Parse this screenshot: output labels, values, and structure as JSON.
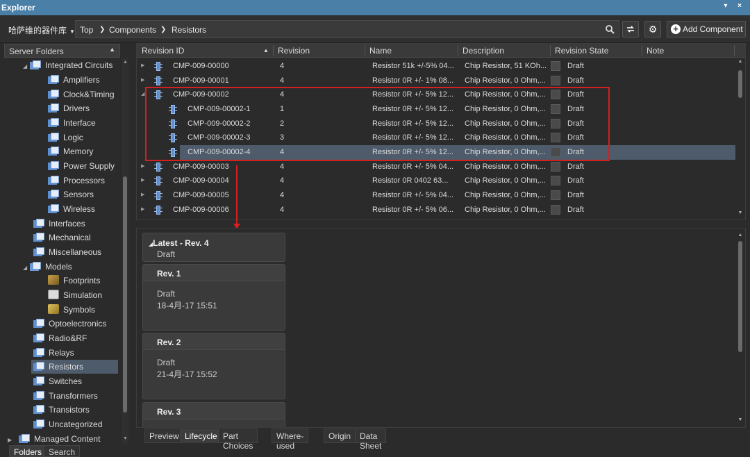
{
  "window": {
    "title": "Explorer",
    "controls": "▾ ×"
  },
  "toolbar": {
    "vault": "哈萨维的器件库",
    "breadcrumb": [
      "Top",
      "Components",
      "Resistors"
    ],
    "add_component": "Add Component"
  },
  "left_panel": {
    "header": "Server Folders",
    "items": [
      {
        "label": "Integrated Circuits",
        "level": 1,
        "expanded": true
      },
      {
        "label": "Amplifiers",
        "level": 2
      },
      {
        "label": "Clock&Timing",
        "level": 2
      },
      {
        "label": "Drivers",
        "level": 2
      },
      {
        "label": "Interface",
        "level": 2
      },
      {
        "label": "Logic",
        "level": 2
      },
      {
        "label": "Memory",
        "level": 2
      },
      {
        "label": "Power Supply",
        "level": 2
      },
      {
        "label": "Processors",
        "level": 2
      },
      {
        "label": "Sensors",
        "level": 2
      },
      {
        "label": "Wireless",
        "level": 2
      },
      {
        "label": "Interfaces",
        "level": 1
      },
      {
        "label": "Mechanical",
        "level": 1
      },
      {
        "label": "Miscellaneous",
        "level": 1
      },
      {
        "label": "Models",
        "level": 1,
        "expanded": true
      },
      {
        "label": "Footprints",
        "level": 2
      },
      {
        "label": "Simulation",
        "level": 2
      },
      {
        "label": "Symbols",
        "level": 2
      },
      {
        "label": "Optoelectronics",
        "level": 1
      },
      {
        "label": "Radio&RF",
        "level": 1
      },
      {
        "label": "Relays",
        "level": 1
      },
      {
        "label": "Resistors",
        "level": 1,
        "selected": true
      },
      {
        "label": "Switches",
        "level": 1
      },
      {
        "label": "Transformers",
        "level": 1
      },
      {
        "label": "Transistors",
        "level": 1
      },
      {
        "label": "Uncategorized",
        "level": 1
      },
      {
        "label": "Managed Content",
        "level": 0
      }
    ],
    "tabs": [
      "Folders",
      "Search"
    ]
  },
  "grid": {
    "columns": [
      "Revision ID",
      "Revision",
      "Name",
      "Description",
      "Revision State",
      "Note"
    ],
    "rows": [
      {
        "id": "CMP-009-00000",
        "rev": "4",
        "name": "Resistor 51k +/-5% 04...",
        "desc": "Chip Resistor, 51 KOh...",
        "state": "Draft"
      },
      {
        "id": "CMP-009-00001",
        "rev": "4",
        "name": "Resistor 0R +/- 1% 08...",
        "desc": "Chip Resistor, 0 Ohm,...",
        "state": "Draft"
      },
      {
        "id": "CMP-009-00002",
        "rev": "4",
        "name": "Resistor 0R +/- 5% 12...",
        "desc": "Chip Resistor, 0 Ohm,...",
        "state": "Draft",
        "expanded": true
      },
      {
        "id": "CMP-009-00002-1",
        "rev": "1",
        "name": "Resistor 0R +/- 5% 12...",
        "desc": "Chip Resistor, 0 Ohm,...",
        "state": "Draft",
        "child": true
      },
      {
        "id": "CMP-009-00002-2",
        "rev": "2",
        "name": "Resistor 0R +/- 5% 12...",
        "desc": "Chip Resistor, 0 Ohm,...",
        "state": "Draft",
        "child": true
      },
      {
        "id": "CMP-009-00002-3",
        "rev": "3",
        "name": "Resistor 0R +/- 5% 12...",
        "desc": "Chip Resistor, 0 Ohm,...",
        "state": "Draft",
        "child": true
      },
      {
        "id": "CMP-009-00002-4",
        "rev": "4",
        "name": "Resistor 0R +/- 5% 12...",
        "desc": "Chip Resistor, 0 Ohm,...",
        "state": "Draft",
        "child": true,
        "selected": true
      },
      {
        "id": "CMP-009-00003",
        "rev": "4",
        "name": "Resistor 0R +/- 5% 04...",
        "desc": "Chip Resistor, 0 Ohm,...",
        "state": "Draft"
      },
      {
        "id": "CMP-009-00004",
        "rev": "4",
        "name": "Resistor 0R 0402 63...",
        "desc": "Chip Resistor, 0 Ohm,...",
        "state": "Draft"
      },
      {
        "id": "CMP-009-00005",
        "rev": "4",
        "name": "Resistor 0R +/- 5% 04...",
        "desc": "Chip Resistor, 0 Ohm,...",
        "state": "Draft"
      },
      {
        "id": "CMP-009-00006",
        "rev": "4",
        "name": "Resistor 0R +/- 5% 06...",
        "desc": "Chip Resistor, 0 Ohm,...",
        "state": "Draft"
      }
    ]
  },
  "lifecycle": {
    "latest": {
      "title": "Latest - Rev.  4",
      "state": "Draft"
    },
    "revisions": [
      {
        "title": "Rev. 1",
        "state": "Draft",
        "date": "18-4月-17 15:51"
      },
      {
        "title": "Rev. 2",
        "state": "Draft",
        "date": "21-4月-17 15:52"
      },
      {
        "title": "Rev. 3"
      }
    ]
  },
  "detail_tabs": [
    "Preview",
    "Lifecycle",
    "Part Choices",
    "Where-used",
    "Origin",
    "Data Sheet"
  ],
  "colors": {
    "titlebar": "#4a7fa8",
    "selection": "#4d5b6b",
    "annotation": "#d32020"
  }
}
